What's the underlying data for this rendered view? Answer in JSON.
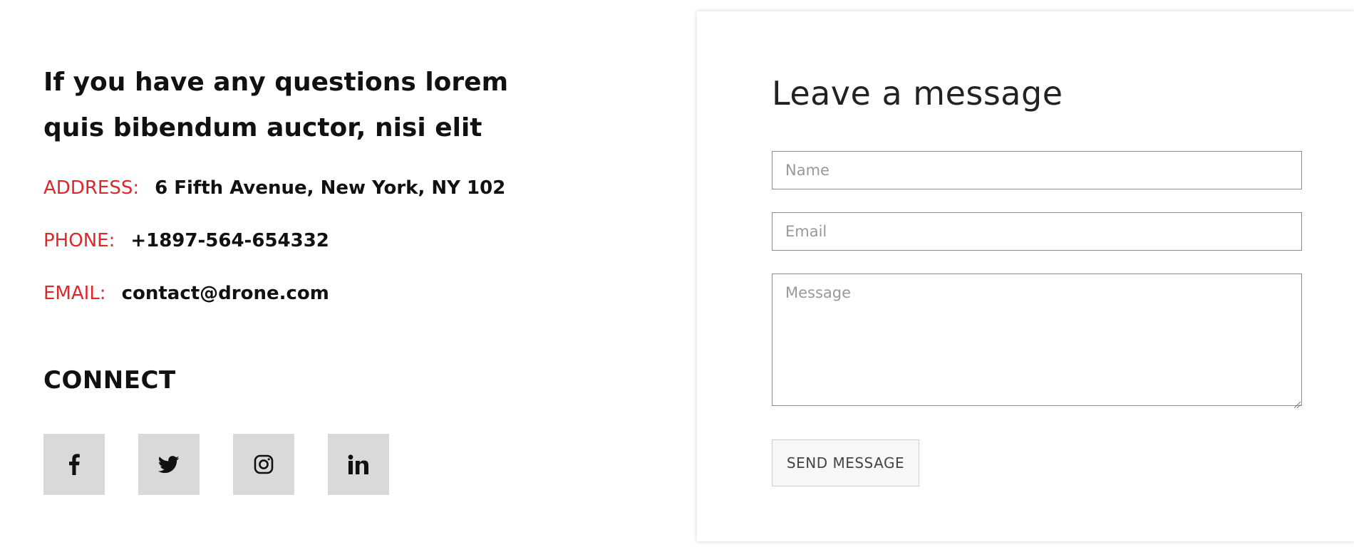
{
  "contact_info": {
    "headline": "If you have any questions lorem quis bibendum auctor, nisi elit",
    "address": {
      "label": "ADDRESS:",
      "value": "6 Fifth Avenue, New York, NY 102"
    },
    "phone": {
      "label": "PHONE:",
      "value": "+1897-564-654332"
    },
    "email": {
      "label": "EMAIL:",
      "value": "contact@drone.com"
    }
  },
  "connect": {
    "title": "CONNECT",
    "social": [
      {
        "icon": "facebook-icon"
      },
      {
        "icon": "twitter-icon"
      },
      {
        "icon": "instagram-icon"
      },
      {
        "icon": "linkedin-icon"
      }
    ]
  },
  "form": {
    "title": "Leave a message",
    "name_placeholder": "Name",
    "name_value": "",
    "email_placeholder": "Email",
    "email_value": "",
    "message_placeholder": "Message",
    "message_value": "",
    "submit_label": "SEND MESSAGE"
  },
  "colors": {
    "accent": "#e0262b",
    "text": "#111111",
    "social_bg": "#d9d9d9"
  }
}
